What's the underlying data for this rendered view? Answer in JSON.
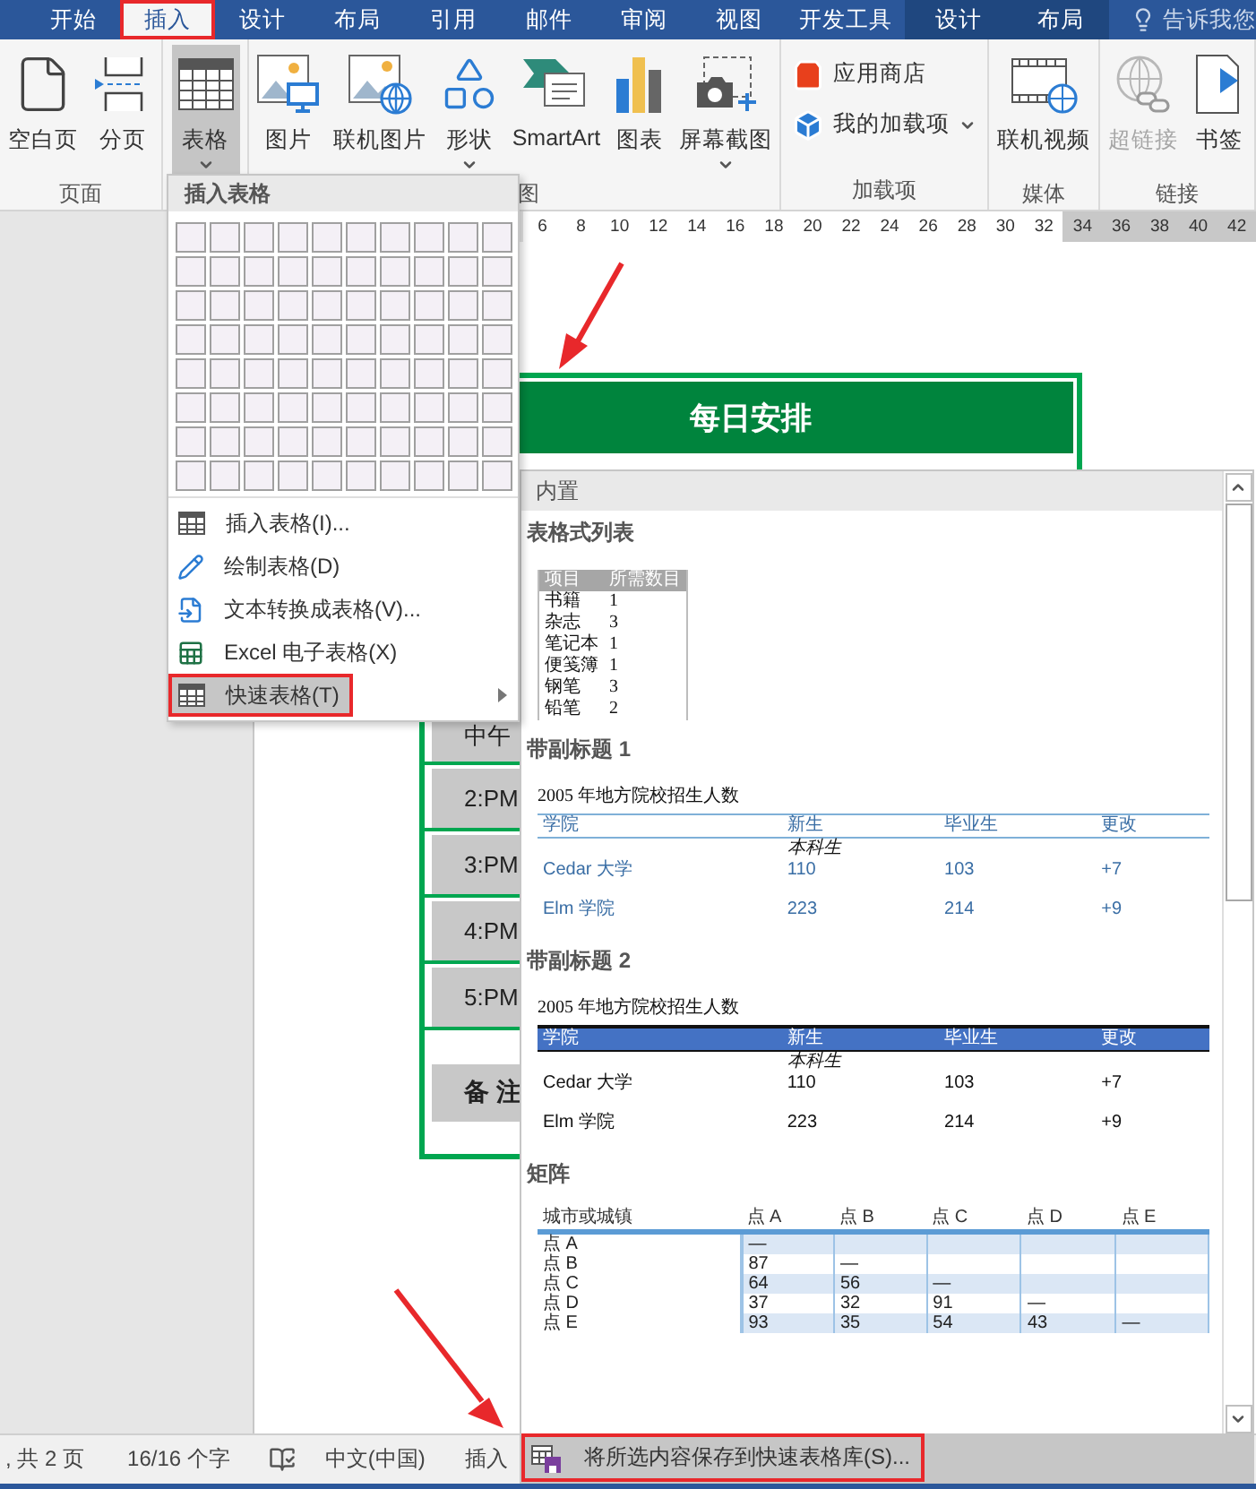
{
  "ribbon_tabs": [
    {
      "label": "开始",
      "selected": false,
      "context": false,
      "annotated": false
    },
    {
      "label": "插入",
      "selected": true,
      "context": false,
      "annotated": true
    },
    {
      "label": "设计",
      "selected": false,
      "context": false,
      "annotated": false
    },
    {
      "label": "布局",
      "selected": false,
      "context": false,
      "annotated": false
    },
    {
      "label": "引用",
      "selected": false,
      "context": false,
      "annotated": false
    },
    {
      "label": "邮件",
      "selected": false,
      "context": false,
      "annotated": false
    },
    {
      "label": "审阅",
      "selected": false,
      "context": false,
      "annotated": false
    },
    {
      "label": "视图",
      "selected": false,
      "context": false,
      "annotated": false
    },
    {
      "label": "开发工具",
      "selected": false,
      "context": false,
      "annotated": false
    },
    {
      "label": "设计",
      "selected": false,
      "context": true,
      "annotated": false
    },
    {
      "label": "布局",
      "selected": false,
      "context": true,
      "annotated": false
    }
  ],
  "tell_me": "告诉我您",
  "ribbon_groups": [
    {
      "label": "页面",
      "buttons": [
        {
          "label": "空白页",
          "kind": "large",
          "dropdown": false,
          "pressed": false,
          "disabled": false
        },
        {
          "label": "分页",
          "kind": "large",
          "dropdown": false,
          "pressed": false,
          "disabled": false
        }
      ]
    },
    {
      "buttons": [
        {
          "label": "表格",
          "kind": "large",
          "dropdown": true,
          "pressed": true,
          "disabled": false
        }
      ]
    },
    {
      "label": "图",
      "buttons": [
        {
          "label": "图片",
          "kind": "large",
          "dropdown": false,
          "pressed": false,
          "disabled": false
        },
        {
          "label": "联机图片",
          "kind": "large",
          "dropdown": false,
          "pressed": false,
          "disabled": false
        },
        {
          "label": "形状",
          "kind": "large",
          "dropdown": true,
          "pressed": false,
          "disabled": false
        },
        {
          "label": "SmartArt",
          "kind": "large",
          "dropdown": false,
          "pressed": false,
          "disabled": false
        },
        {
          "label": "图表",
          "kind": "large",
          "dropdown": false,
          "pressed": false,
          "disabled": false
        },
        {
          "label": "屏幕截图",
          "kind": "large",
          "dropdown": true,
          "pressed": false,
          "disabled": false
        }
      ]
    },
    {
      "label": "加载项",
      "buttons": [
        {
          "label": "应用商店",
          "kind": "small",
          "dropdown": false,
          "pressed": false,
          "disabled": false
        },
        {
          "label": "我的加载项",
          "kind": "small",
          "dropdown": true,
          "pressed": false,
          "disabled": false
        }
      ]
    },
    {
      "label": "媒体",
      "buttons": [
        {
          "label": "联机视频",
          "kind": "large",
          "dropdown": false,
          "pressed": false,
          "disabled": false
        }
      ]
    },
    {
      "label": "链接",
      "buttons": [
        {
          "label": "超链接",
          "kind": "large",
          "dropdown": false,
          "pressed": false,
          "disabled": true
        },
        {
          "label": "书签",
          "kind": "large",
          "dropdown": false,
          "pressed": false,
          "disabled": false
        }
      ]
    }
  ],
  "ruler": [
    {
      "label": "6",
      "margin": false
    },
    {
      "label": "8",
      "margin": false
    },
    {
      "label": "10",
      "margin": false
    },
    {
      "label": "12",
      "margin": false
    },
    {
      "label": "14",
      "margin": false
    },
    {
      "label": "16",
      "margin": false
    },
    {
      "label": "18",
      "margin": false
    },
    {
      "label": "20",
      "margin": false
    },
    {
      "label": "22",
      "margin": false
    },
    {
      "label": "24",
      "margin": false
    },
    {
      "label": "26",
      "margin": false
    },
    {
      "label": "28",
      "margin": false
    },
    {
      "label": "30",
      "margin": false
    },
    {
      "label": "32",
      "margin": false
    },
    {
      "label": "34",
      "margin": true
    },
    {
      "label": "36",
      "margin": true
    },
    {
      "label": "38",
      "margin": true
    },
    {
      "label": "40",
      "margin": true
    },
    {
      "label": "42",
      "margin": true
    }
  ],
  "document_table": {
    "title": "每日安排",
    "rows": [
      {
        "kind": "time",
        "label": "中午"
      },
      {
        "kind": "time",
        "label": "2:PM"
      },
      {
        "kind": "time",
        "label": "3:PM"
      },
      {
        "kind": "time",
        "label": "4:PM"
      },
      {
        "kind": "time",
        "label": "5:PM"
      },
      {
        "kind": "gap"
      },
      {
        "kind": "notes",
        "label": "备 注"
      }
    ]
  },
  "table_menu": {
    "header": "插入表格",
    "items": [
      {
        "label": "插入表格(I)...",
        "selected": false,
        "submenu": false,
        "annotated": false
      },
      {
        "label": "绘制表格(D)",
        "selected": false,
        "submenu": false,
        "annotated": false
      },
      {
        "label": "文本转换成表格(V)...",
        "selected": false,
        "submenu": false,
        "annotated": false
      },
      {
        "label": "Excel 电子表格(X)",
        "selected": false,
        "submenu": false,
        "annotated": false
      },
      {
        "label": "快速表格(T)",
        "selected": true,
        "submenu": true,
        "annotated": true
      }
    ]
  },
  "quick_tables": {
    "header": "内置",
    "sections": [
      {
        "kind": "list",
        "title": "表格式列表",
        "columns": [
          "项目",
          "所需数目"
        ],
        "rows": [
          [
            "书籍",
            "1"
          ],
          [
            "杂志",
            "3"
          ],
          [
            "笔记本",
            "1"
          ],
          [
            "便笺簿",
            "1"
          ],
          [
            "钢笔",
            "3"
          ],
          [
            "铅笔",
            "2"
          ]
        ]
      },
      {
        "kind": "subheads",
        "title": "带副标题 1",
        "header_band": false,
        "caption": "2005 年地方院校招生人数",
        "columns": [
          "学院",
          "新生",
          "毕业生",
          "更改"
        ],
        "subheading": "本科生",
        "rows": [
          [
            "Cedar 大学",
            "110",
            "103",
            "+7"
          ],
          [
            "Elm 学院",
            "223",
            "214",
            "+9"
          ]
        ]
      },
      {
        "kind": "subheads",
        "title": "带副标题 2",
        "header_band": true,
        "caption": "2005 年地方院校招生人数",
        "columns": [
          "学院",
          "新生",
          "毕业生",
          "更改"
        ],
        "subheading": "本科生",
        "rows": [
          [
            "Cedar 大学",
            "110",
            "103",
            "+7"
          ],
          [
            "Elm 学院",
            "223",
            "214",
            "+9"
          ]
        ]
      },
      {
        "kind": "matrix",
        "title": "矩阵",
        "columns": [
          "城市或城镇",
          "点 A",
          "点 B",
          "点 C",
          "点 D",
          "点 E"
        ],
        "rows": [
          [
            "点 A",
            "—"
          ],
          [
            "点 B",
            "87",
            "—"
          ],
          [
            "点 C",
            "64",
            "56",
            "—"
          ],
          [
            "点 D",
            "37",
            "32",
            "91",
            "—"
          ],
          [
            "点 E",
            "93",
            "35",
            "54",
            "43",
            "—"
          ]
        ]
      }
    ],
    "save_button": {
      "label": "将所选内容保存到快速表格库(S)...",
      "annotated": true
    }
  },
  "status_bar": [
    ", 共 2 页",
    "16/16 个字",
    "中文(中国)",
    "插入"
  ]
}
